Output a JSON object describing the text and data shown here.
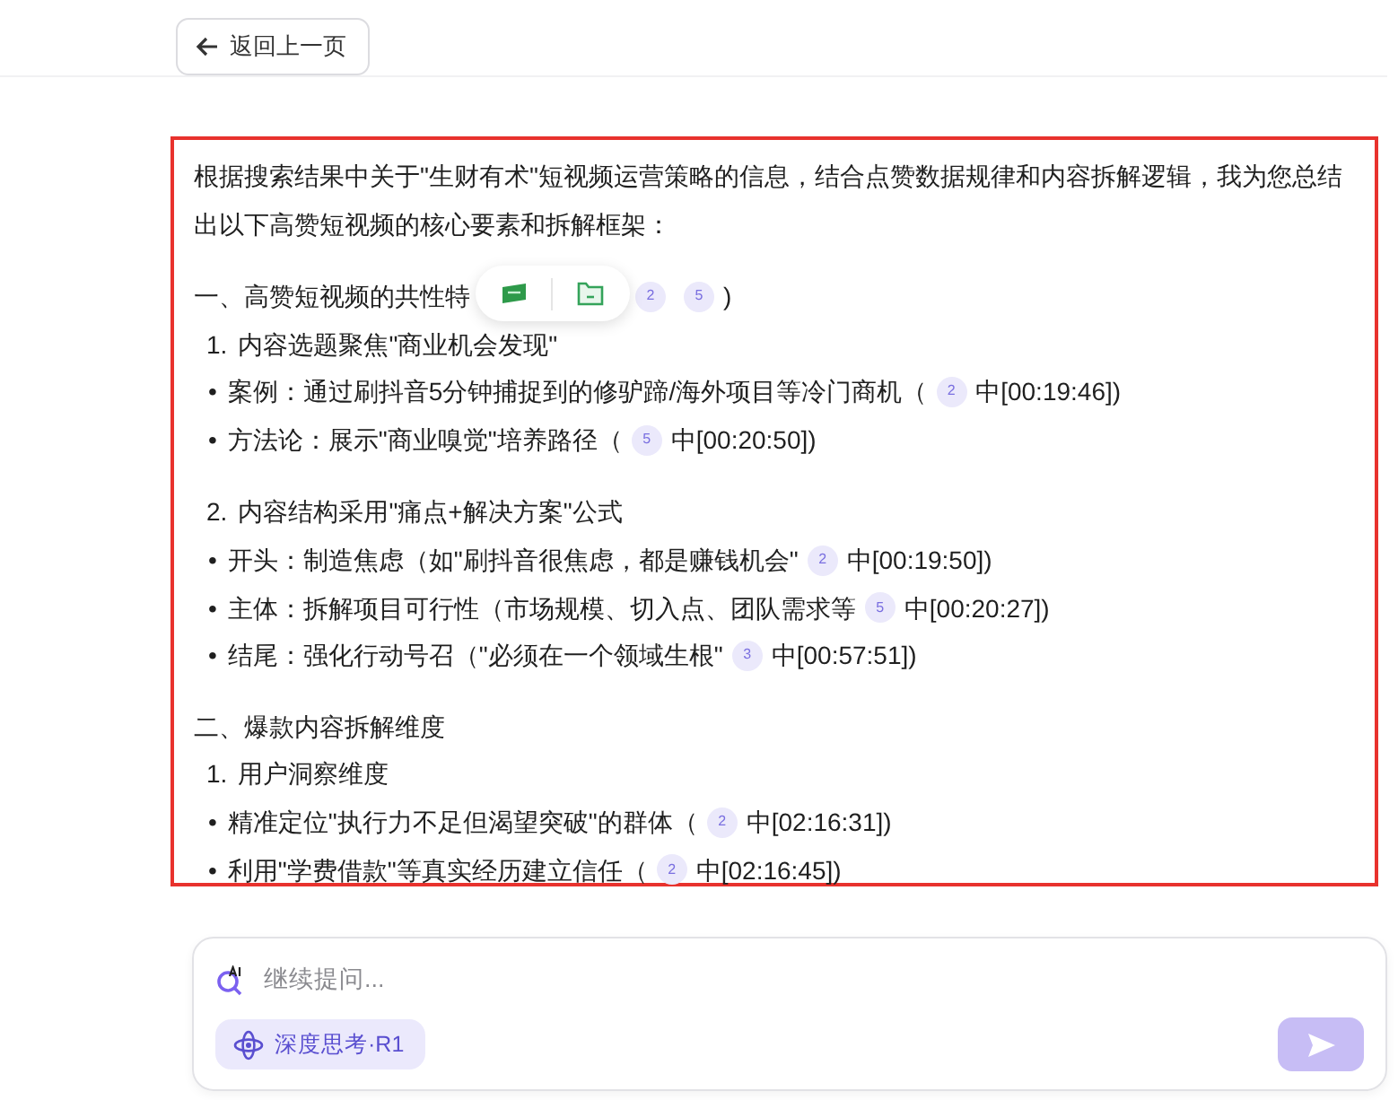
{
  "back_button": {
    "label": "返回上一页"
  },
  "answer": {
    "lines": [
      {
        "kind": "para",
        "parts": [
          {
            "text": "根据搜索结果中关于\"生财有术\"短视频运营策略的信息，结合点赞数据规律和内容拆解逻辑，我为您总结出以下高赞短视频的核心要素和拆解框架："
          }
        ]
      },
      {
        "kind": "heading",
        "parts": [
          {
            "text": "一、高赞短视频的共性特"
          },
          {
            "cite": "2"
          },
          {
            "cite": "5"
          },
          {
            "text": ")"
          }
        ]
      },
      {
        "kind": "sub",
        "marker": "1.",
        "parts": [
          {
            "text": "内容选题聚焦\"商业机会发现\""
          }
        ]
      },
      {
        "kind": "bullet",
        "marker": "•",
        "parts": [
          {
            "text": "案例：通过刷抖音5分钟捕捉到的修驴蹄/海外项目等冷门商机（"
          },
          {
            "cite": "2"
          },
          {
            "text": "中[00:19:46])"
          }
        ]
      },
      {
        "kind": "bullet",
        "marker": "•",
        "parts": [
          {
            "text": "方法论：展示\"商业嗅觉\"培养路径（"
          },
          {
            "cite": "5"
          },
          {
            "text": "中[00:20:50])"
          }
        ]
      },
      {
        "kind": "sub",
        "marker": "2.",
        "parts": [
          {
            "text": "内容结构采用\"痛点+解决方案\"公式"
          }
        ]
      },
      {
        "kind": "bullet",
        "marker": "•",
        "parts": [
          {
            "text": "开头：制造焦虑（如\"刷抖音很焦虑，都是赚钱机会\""
          },
          {
            "cite": "2"
          },
          {
            "text": "中[00:19:50])"
          }
        ]
      },
      {
        "kind": "bullet",
        "marker": "•",
        "parts": [
          {
            "text": "主体：拆解项目可行性（市场规模、切入点、团队需求等"
          },
          {
            "cite": "5"
          },
          {
            "text": "中[00:20:27])"
          }
        ]
      },
      {
        "kind": "bullet",
        "marker": "•",
        "parts": [
          {
            "text": "结尾：强化行动号召（\"必须在一个领域生根\""
          },
          {
            "cite": "3"
          },
          {
            "text": "中[00:57:51])"
          }
        ]
      },
      {
        "kind": "heading",
        "parts": [
          {
            "text": "二、爆款内容拆解维度"
          }
        ]
      },
      {
        "kind": "sub",
        "marker": "1.",
        "parts": [
          {
            "text": "用户洞察维度"
          }
        ]
      },
      {
        "kind": "bullet",
        "marker": "•",
        "parts": [
          {
            "text": "精准定位\"执行力不足但渴望突破\"的群体（"
          },
          {
            "cite": "2"
          },
          {
            "text": "中[02:16:31])"
          }
        ]
      },
      {
        "kind": "bullet",
        "marker": "•",
        "parts": [
          {
            "text": "利用\"学费借款\"等真实经历建立信任（"
          },
          {
            "cite": "2"
          },
          {
            "text": "中[02:16:45])"
          }
        ]
      }
    ]
  },
  "composer": {
    "placeholder": "继续提问...",
    "deep_think": {
      "label": "深度思考·R1",
      "selected": true
    },
    "send_disabled": true
  }
}
